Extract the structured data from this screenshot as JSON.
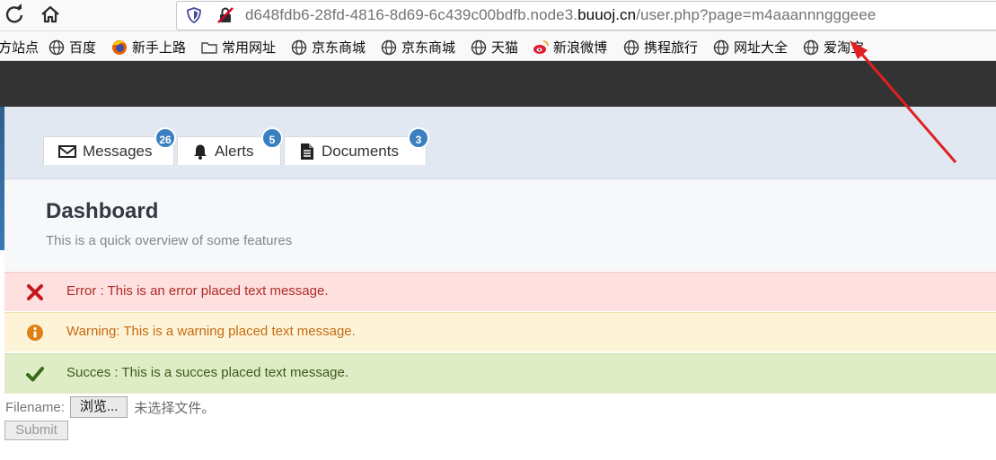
{
  "browser": {
    "url_prefix": "d648fdb6-28fd-4816-8d69-6c439c00bdfb.node3.",
    "url_domain": "buuoj.cn",
    "url_suffix": "/user.php?page=m4aaannngggeee",
    "bookmarks": [
      {
        "label": "方站点",
        "icon": "none"
      },
      {
        "label": "百度",
        "icon": "globe-icon"
      },
      {
        "label": "新手上路",
        "icon": "firefox-icon"
      },
      {
        "label": "常用网址",
        "icon": "folder-icon"
      },
      {
        "label": "京东商城",
        "icon": "globe-icon"
      },
      {
        "label": "京东商城",
        "icon": "globe-icon"
      },
      {
        "label": "天猫",
        "icon": "globe-icon"
      },
      {
        "label": "新浪微博",
        "icon": "weibo-icon"
      },
      {
        "label": "携程旅行",
        "icon": "globe-icon"
      },
      {
        "label": "网址大全",
        "icon": "globe-icon"
      },
      {
        "label": "爱淘宝",
        "icon": "globe-icon"
      }
    ]
  },
  "tabs": [
    {
      "label": "Messages",
      "badge": "26",
      "icon": "envelope-icon"
    },
    {
      "label": "Alerts",
      "badge": "5",
      "icon": "bell-icon"
    },
    {
      "label": "Documents",
      "badge": "3",
      "icon": "document-icon"
    }
  ],
  "header": {
    "title": "Dashboard",
    "subtitle": "This is a quick overview of some features"
  },
  "alerts": {
    "error": "Error : This is an error placed text message.",
    "warning": "Warning: This is a warning placed text message.",
    "success": "Succes : This is a succes placed text message."
  },
  "form": {
    "filename_label": "Filename:",
    "browse_label": "浏览...",
    "file_status": "未选择文件。",
    "submit_label": "Submit"
  },
  "colors": {
    "accent_badge": "#3a80c1",
    "dark_bar": "#333333",
    "error_bg": "#fde0df",
    "warning_bg": "#fdf4d8",
    "success_bg": "#dfedc7",
    "annotation_arrow": "#e02020"
  }
}
